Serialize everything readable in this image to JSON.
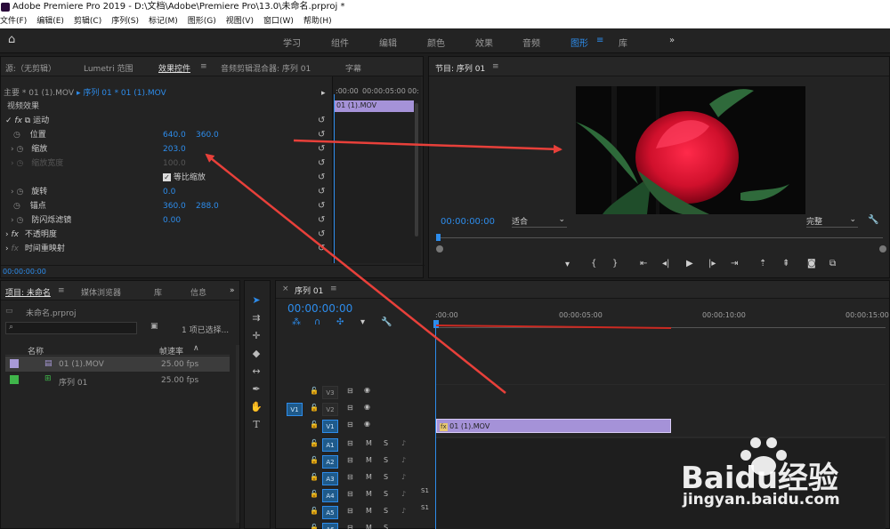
{
  "window": {
    "title": "Adobe Premiere Pro 2019 - D:\\文档\\Adobe\\Premiere Pro\\13.0\\未命名.prproj *"
  },
  "menu": [
    "文件(F)",
    "编辑(E)",
    "剪辑(C)",
    "序列(S)",
    "标记(M)",
    "图形(G)",
    "视图(V)",
    "窗口(W)",
    "帮助(H)"
  ],
  "workspaces": [
    "学习",
    "组件",
    "编辑",
    "颜色",
    "效果",
    "音频",
    "图形",
    "库"
  ],
  "source_panel": {
    "tabs": [
      "源:（无剪辑）",
      "Lumetri 范围",
      "效果控件",
      "音频剪辑混合器: 序列 01",
      "字幕"
    ],
    "master_label": "主要 * 01 (1).MOV",
    "sequence_label": "序列 01 * 01 (1).MOV",
    "section": "视频效果",
    "motion": "运动",
    "props": [
      {
        "name": "位置",
        "v1": "640.0",
        "v2": "360.0"
      },
      {
        "name": "缩放",
        "v1": "203.0",
        "v2": ""
      },
      {
        "name": "缩放宽度",
        "v1": "100.0",
        "v2": ""
      },
      {
        "name": "等比缩放",
        "v1": "",
        "v2": ""
      },
      {
        "name": "旋转",
        "v1": "0.0",
        "v2": ""
      },
      {
        "name": "锚点",
        "v1": "360.0",
        "v2": "288.0"
      },
      {
        "name": "防闪烁滤镜",
        "v1": "0.00",
        "v2": ""
      }
    ],
    "opacity": "不透明度",
    "timeremap": "时间重映射",
    "mini_ruler": [
      ":00:00",
      "00:00:05:00",
      "00:"
    ],
    "mini_clip": "01 (1).MOV",
    "timecode": "00:00:00:00"
  },
  "program_panel": {
    "title": "节目: 序列 01",
    "timecode": "00:00:00:00",
    "fit": "适合",
    "quality": "完整"
  },
  "project_panel": {
    "tabs": [
      "项目: 未命名",
      "媒体浏览器",
      "库",
      "信息"
    ],
    "file": "未命名.prproj",
    "selection": "1 项已选择...",
    "col_name": "名称",
    "col_rate": "帧速率",
    "items": [
      {
        "name": "01 (1).MOV",
        "rate": "25.00 fps",
        "color": "#a89ad8"
      },
      {
        "name": "序列 01",
        "rate": "25.00 fps",
        "color": "#3fb54a"
      }
    ]
  },
  "timeline": {
    "tab": "序列 01",
    "timecode": "00:00:00:00",
    "ruler": [
      ":00:00",
      "00:00:05:00",
      "00:00:10:00",
      "00:00:15:00"
    ],
    "video_tracks": [
      "V3",
      "V2",
      "V1"
    ],
    "audio_tracks": [
      "A1",
      "A2",
      "A3",
      "A4",
      "A5",
      "A6"
    ],
    "source_patch": "V1",
    "clip": "01 (1).MOV",
    "audio_label": "S1"
  },
  "watermark": {
    "brand": "Baidu经验",
    "url": "jingyan.baidu.com"
  },
  "colors": {
    "accent": "#2d8ceb",
    "clip": "#a592d8",
    "arrow": "#e8403a"
  }
}
